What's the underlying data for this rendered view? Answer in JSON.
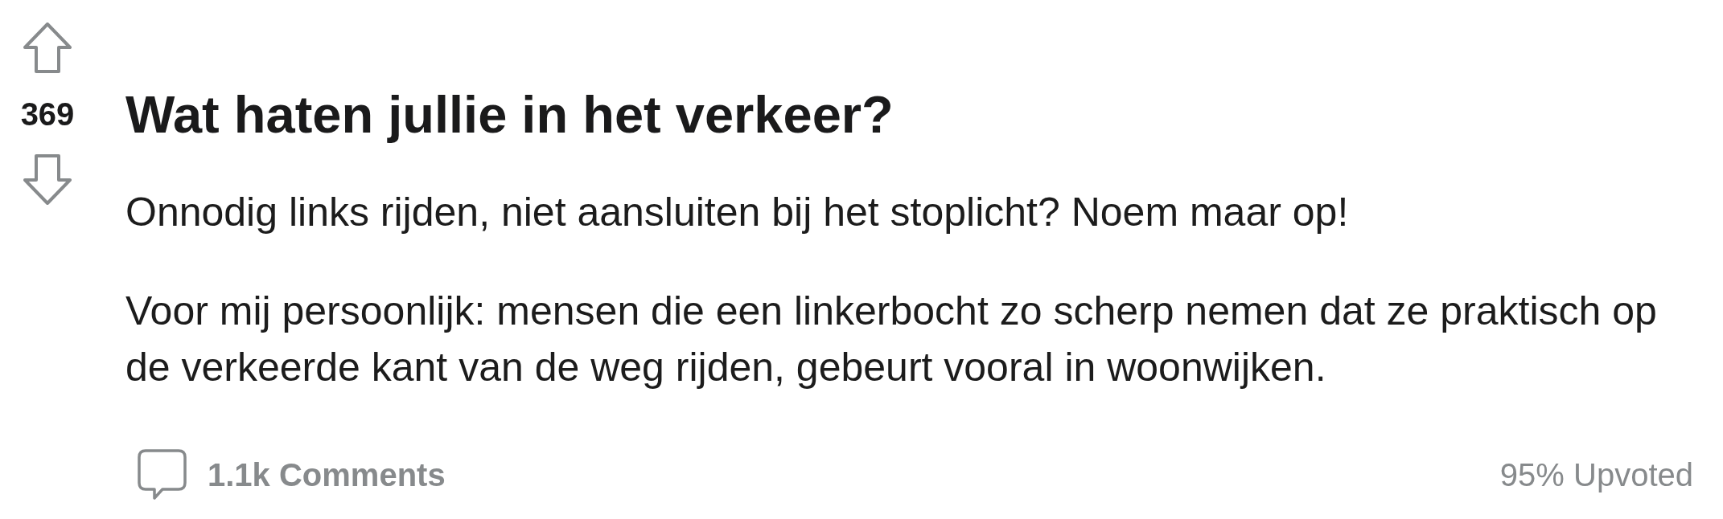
{
  "post": {
    "upvoted": false,
    "downvoted": false,
    "score": "369",
    "title": "Wat haten jullie in het verkeer?",
    "body": [
      "Onnodig links rijden, niet aansluiten bij het stoplicht? Noem maar op!",
      "Voor mij persoonlijk: mensen die een linkerbocht zo scherp nemen dat ze praktisch op de verkeerde kant van de weg rijden, gebeurt vooral in woonwijken."
    ]
  },
  "footer": {
    "comments": "1.1k Comments",
    "upvote_ratio": "95% Upvoted"
  }
}
